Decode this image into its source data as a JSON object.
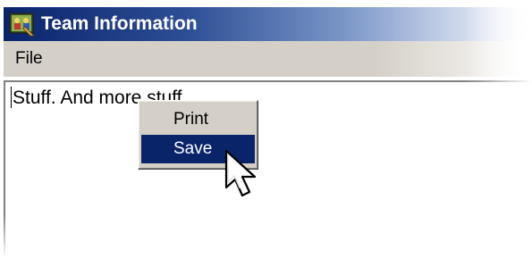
{
  "window": {
    "title": "Team Information",
    "icon": "team-app-icon"
  },
  "menubar": {
    "items": [
      {
        "label": "File"
      }
    ]
  },
  "editor": {
    "text": "Stuff. And more stuff."
  },
  "context_menu": {
    "items": [
      {
        "label": "Print",
        "highlighted": false
      },
      {
        "label": "Save",
        "highlighted": true
      }
    ]
  },
  "colors": {
    "titlebar": "#0a246a",
    "menu_face": "#d4d0c8",
    "highlight": "#0a246a",
    "highlight_text": "#ffffff"
  },
  "cursor": {
    "icon": "arrow-pointer-icon"
  }
}
